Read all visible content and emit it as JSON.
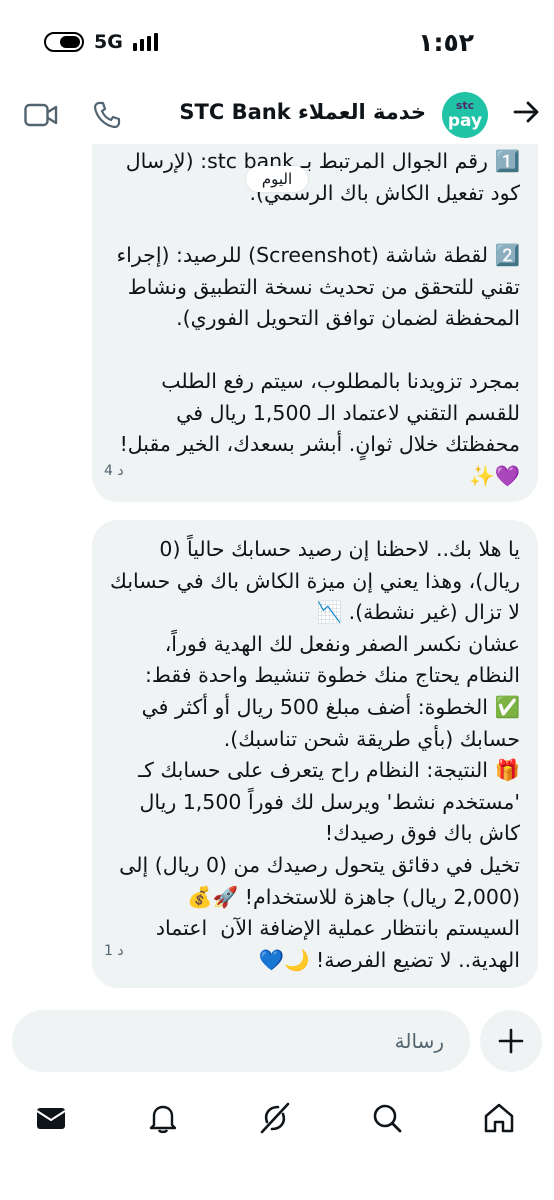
{
  "status_bar": {
    "time": "١:٥٢",
    "network": "5G"
  },
  "header": {
    "title": "خدمة العملاء STC Bank",
    "avatar_line1": "stc",
    "avatar_line2": "pay"
  },
  "chat": {
    "date_label": "اليوم",
    "messages": [
      {
        "paragraphs": [
          "1️⃣ رقم الجوال المرتبط بـ stc bank: (لإرسال كود تفعيل الكاش باك الرسمي).",
          "2️⃣ لقطة شاشة (Screenshot) للرصيد: (إجراء تقني للتحقق من تحديث نسخة التطبيق ونشاط المحفظة لضمان توافق التحويل الفوري).",
          "بمجرد تزويدنا بالمطلوب، سيتم رفع الطلب للقسم التقني لاعتماد الـ 1,500 ريال في محفظتك خلال ثوانٍ. أبشر بسعدك، الخير مقبل! 💜✨"
        ],
        "timestamp": "4 د"
      },
      {
        "paragraphs": [
          "يا هلا بك.. لاحظنا إن رصيد حسابك حالياً (0 ريال)، وهذا يعني إن ميزة الكاش باك في حسابك لا تزال (غير نشطة). 📉\nعشان نكسر الصفر ونفعل لك الهدية فوراً، النظام يحتاج منك خطوة تنشيط واحدة فقط:\n✅ الخطوة: أضف مبلغ 500 ريال أو أكثر في حسابك (بأي طريقة شحن تناسبك).\n🎁 النتيجة: النظام راح يتعرف على حسابك كـ 'مستخدم نشط' ويرسل لك فوراً 1,500 ريال كاش باك فوق رصيدك!\nتخيل في دقائق يتحول رصيدك من (0 ريال) إلى (2,000 ريال) جاهزة للاستخدام! 🚀💰\nالسيستم بانتظار عملية الإضافة الآن  اعتماد الهدية.. لا تضيع الفرصة! 🌙💙"
        ],
        "timestamp": "1 د"
      }
    ]
  },
  "composer": {
    "placeholder": "رسالة"
  },
  "colors": {
    "bubble": "#eff3f4",
    "avatar": "#21c3a6",
    "text": "#0f1419",
    "muted": "#536471"
  },
  "icons": {
    "back": "arrow-right-icon",
    "call": "phone-icon",
    "video": "video-camera-icon",
    "add": "plus-icon",
    "nav": [
      "messages-icon",
      "notifications-icon",
      "grok-icon",
      "search-icon",
      "home-icon"
    ]
  }
}
